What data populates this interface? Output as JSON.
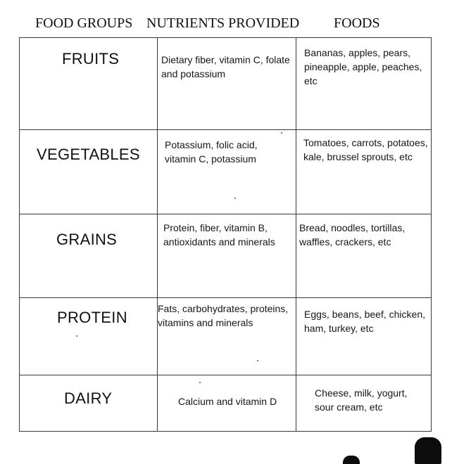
{
  "headers": {
    "food_groups": "FOOD GROUPS",
    "nutrients": "NUTRIENTS PROVIDED",
    "foods": "FOODS"
  },
  "rows": [
    {
      "group": "FRUITS",
      "nutrients": "Dietary fiber, vitamin C, folate and potassium",
      "foods": "Bananas, apples, pears, pineapple, apple, peaches, etc"
    },
    {
      "group": "VEGETABLES",
      "nutrients": "Potassium, folic acid, vitamin C, potassium",
      "foods": "Tomatoes, carrots, potatoes, kale, brussel sprouts, etc"
    },
    {
      "group": "GRAINS",
      "nutrients": "Protein, fiber, vitamin B, antioxidants and minerals",
      "foods": "Bread, noodles, tortillas, waffles, crackers, etc"
    },
    {
      "group": "PROTEIN",
      "nutrients": "Fats, carbohydrates, proteins, vitamins and minerals",
      "foods": "Eggs, beans, beef, chicken, ham, turkey, etc"
    },
    {
      "group": "DAIRY",
      "nutrients": "Calcium and vitamin D",
      "foods": "Cheese, milk, yogurt, sour cream, etc"
    }
  ]
}
